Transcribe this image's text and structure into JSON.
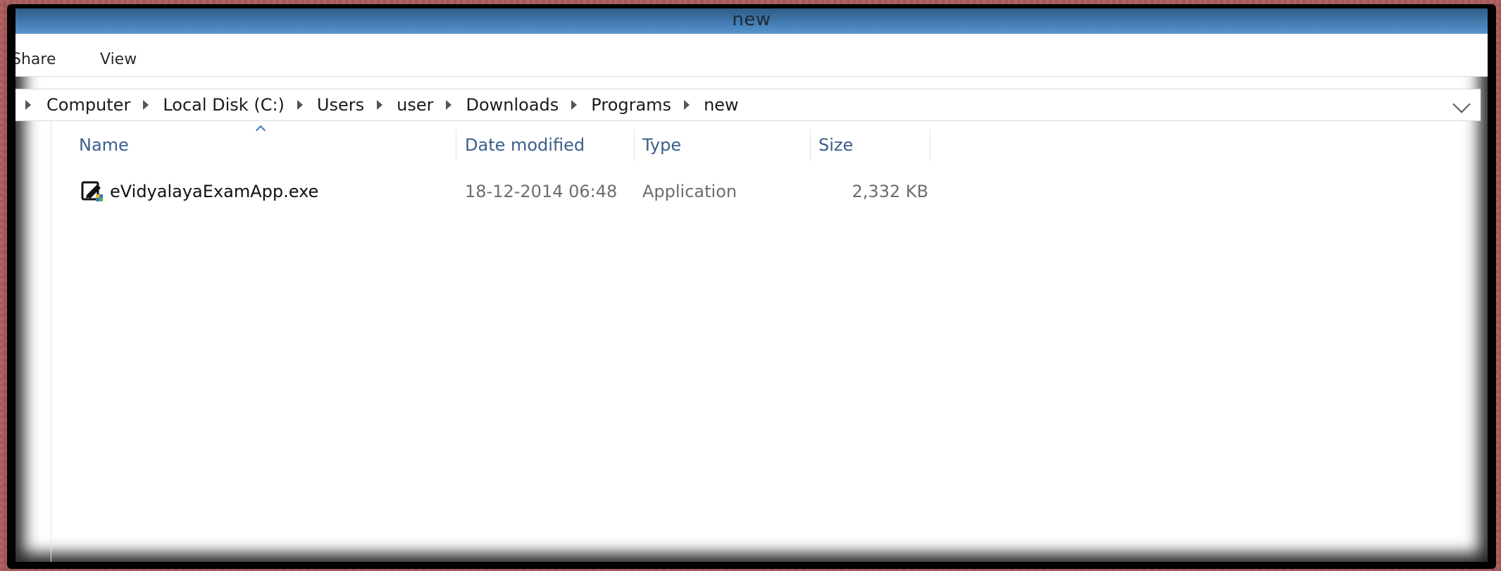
{
  "window": {
    "title": "new"
  },
  "ribbon": {
    "tabs": [
      "Share",
      "View"
    ]
  },
  "address_bar": {
    "breadcrumbs": [
      "Computer",
      "Local Disk (C:)",
      "Users",
      "user",
      "Downloads",
      "Programs",
      "new"
    ]
  },
  "file_list": {
    "columns": [
      "Name",
      "Date modified",
      "Type",
      "Size"
    ],
    "sorted_by": "Name",
    "rows": [
      {
        "name": "eVidyalayaExamApp.exe",
        "date_modified": "18-12-2014 06:48",
        "type": "Application",
        "size": "2,332 KB",
        "icon": "executable-icon"
      }
    ]
  }
}
